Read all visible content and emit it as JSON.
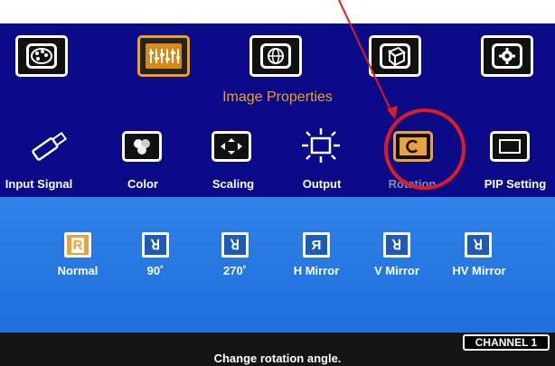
{
  "section_title": "Image Properties",
  "categories": [
    {
      "name": "palette-icon",
      "active": false
    },
    {
      "name": "image-properties-icon",
      "active": true
    },
    {
      "name": "globe-icon",
      "active": false
    },
    {
      "name": "3d-icon",
      "active": false
    },
    {
      "name": "gear-icon",
      "active": false
    }
  ],
  "functions": [
    {
      "label": "Input Signal",
      "icon": "usb-icon"
    },
    {
      "label": "Color",
      "icon": "color-icon"
    },
    {
      "label": "Scaling",
      "icon": "scaling-icon"
    },
    {
      "label": "Output",
      "icon": "output-icon"
    },
    {
      "label": "Rotation",
      "icon": "rotation-icon"
    },
    {
      "label": "PIP Setting",
      "icon": "pip-icon"
    }
  ],
  "rotation_options": [
    {
      "glyph": "R",
      "label": "Normal",
      "selected": true
    },
    {
      "glyph": "ꓤ",
      "label": "90˚",
      "selected": false
    },
    {
      "glyph": "ꓤ",
      "label": "270˚",
      "selected": false
    },
    {
      "glyph": "Я",
      "label": "H Mirror",
      "selected": false
    },
    {
      "glyph": "ꓤ",
      "label": "V Mirror",
      "selected": false
    },
    {
      "glyph": "ꓤ",
      "label": "HV Mirror",
      "selected": false
    }
  ],
  "status_text": "Change rotation angle.",
  "channel": "CHANNEL 1",
  "colors": {
    "menu_background": "#0b0b8a",
    "accent": "#f0a020",
    "options_background": "#2f82e8",
    "annotation": "#e01c1c"
  }
}
